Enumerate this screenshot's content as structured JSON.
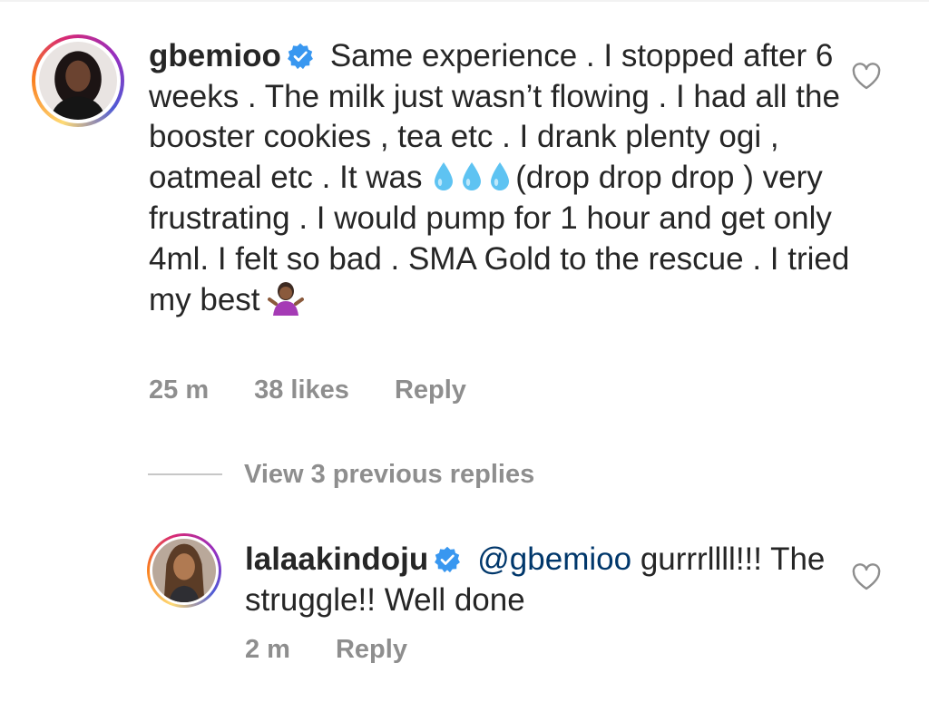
{
  "comments": [
    {
      "username": "gbemioo",
      "verified": true,
      "body_line1": "Same experience . I stopped after 6 weeks . The milk just wasn’t flowing . I had all the booster cookies , tea etc . I drank plenty ogi , oatmeal etc . It was",
      "body_line2": "(drop drop drop ) very frustrating . I would pump for 1 hour and get only 4ml. I felt so bad . SMA Gold to the rescue . I tried my best",
      "emojis": [
        "droplet-emoji",
        "droplet-emoji",
        "droplet-emoji",
        "shrug-emoji"
      ],
      "time": "25 m",
      "likes": "38 likes",
      "reply_label": "Reply"
    }
  ],
  "view_replies_label": "View 3 previous replies",
  "reply": {
    "username": "lalaakindoju",
    "verified": true,
    "mention": "@gbemioo",
    "body": "gurrrllll!!! The struggle!! Well done",
    "time": "2 m",
    "reply_label": "Reply"
  },
  "colors": {
    "text": "#262626",
    "meta": "#8e8e8e",
    "verified": "#3897f0",
    "mention": "#00376b"
  },
  "icons": [
    "verified-badge-icon",
    "heart-outline-icon"
  ]
}
